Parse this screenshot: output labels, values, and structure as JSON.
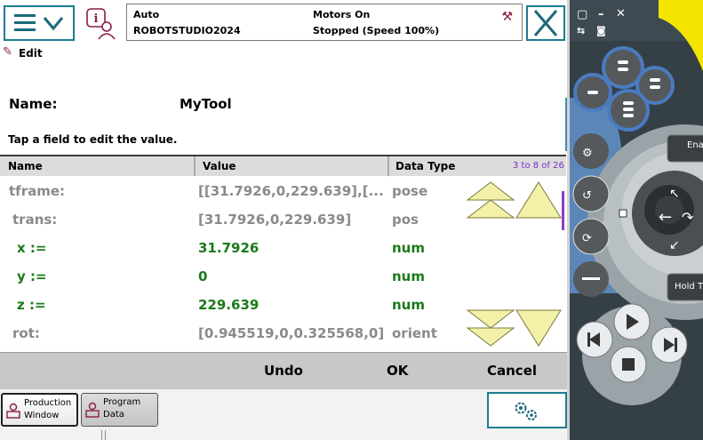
{
  "header": {
    "mode": "Auto",
    "system": "ROBOTSTUDIO2024",
    "motors": "Motors On",
    "state": "Stopped (Speed 100%)",
    "menu_icon": "hamburger-menu-icon",
    "close_icon": "close-icon"
  },
  "edit": {
    "title": "Edit",
    "name_label": "Name:",
    "name_value": "MyTool",
    "hint": "Tap a field to edit the value."
  },
  "table": {
    "headers": {
      "name": "Name",
      "value": "Value",
      "type": "Data Type"
    },
    "page_indicator": "3 to 8 of 26",
    "rows": [
      {
        "name": "tframe:",
        "value": "[[31.7926,0,229.639],[...",
        "type": "pose",
        "style": "gray"
      },
      {
        "name": "trans:",
        "value": "[31.7926,0,229.639]",
        "type": "pos",
        "style": "gray"
      },
      {
        "name": "x :=",
        "value": "31.7926",
        "type": "num",
        "style": "green"
      },
      {
        "name": "y :=",
        "value": "0",
        "type": "num",
        "style": "green"
      },
      {
        "name": "z :=",
        "value": "229.639",
        "type": "num",
        "style": "green"
      },
      {
        "name": "rot:",
        "value": "[0.945519,0,0.325568,0]",
        "type": "orient",
        "style": "gray"
      }
    ]
  },
  "actions": {
    "undo": "Undo",
    "ok": "OK",
    "cancel": "Cancel"
  },
  "taskbar": {
    "production_line1": "Production",
    "production_line2": "Window",
    "program_line1": "Program",
    "program_line2": "Data"
  },
  "pendant": {
    "enable_label": "Ena",
    "hold_label": "Hold T"
  },
  "colors": {
    "accent": "#1a7d8f",
    "editable_text": "#1a7a1a",
    "readonly_text": "#8a8a8a",
    "page_indicator": "#7a2fc4",
    "scroll_arrow": "#f3f0a8"
  }
}
